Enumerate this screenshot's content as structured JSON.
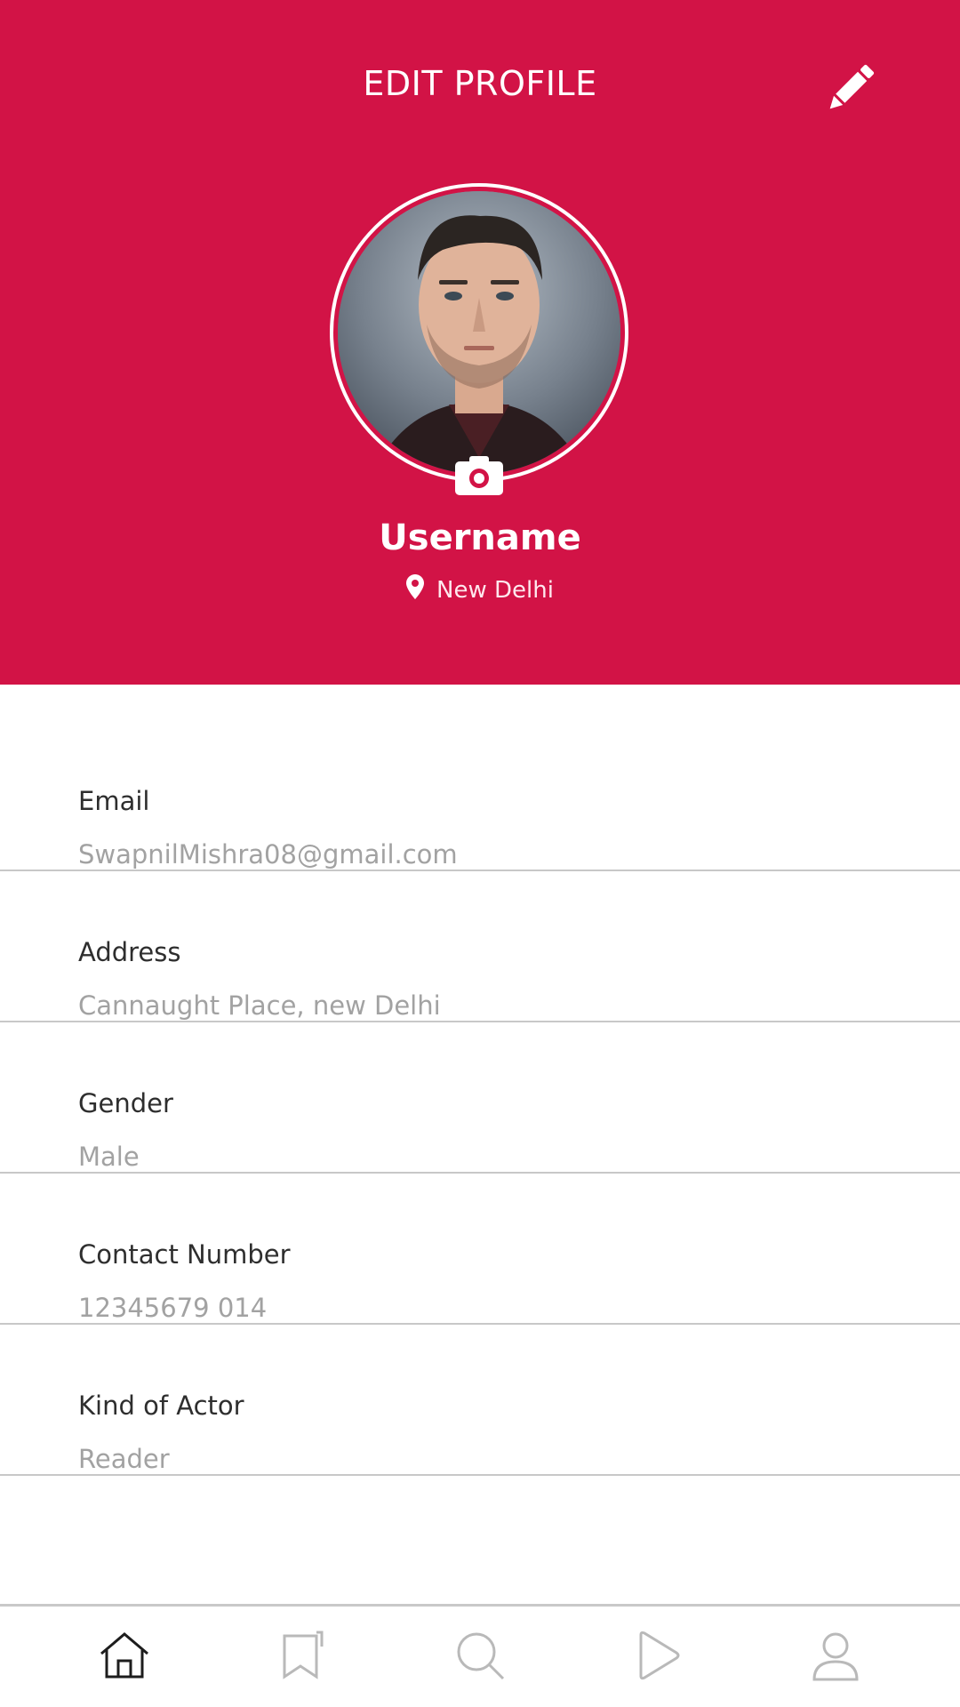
{
  "header": {
    "title": "EDIT PROFILE",
    "accent_color": "#D21346",
    "edit_icon": "pencil-icon"
  },
  "profile": {
    "username": "Username",
    "location": "New Delhi",
    "location_icon": "map-pin-icon",
    "camera_icon": "camera-icon"
  },
  "fields": [
    {
      "label": "Email",
      "value": "SwapnilMishra08@gmail.com"
    },
    {
      "label": "Address",
      "value": "Cannaught Place, new Delhi"
    },
    {
      "label": "Gender",
      "value": "Male"
    },
    {
      "label": "Contact Number",
      "value": "12345679 014"
    },
    {
      "label": "Kind of Actor",
      "value": "Reader"
    }
  ],
  "bottom_nav": {
    "items": [
      "home-icon",
      "bookmark-icon",
      "search-icon",
      "play-icon",
      "profile-icon"
    ]
  }
}
